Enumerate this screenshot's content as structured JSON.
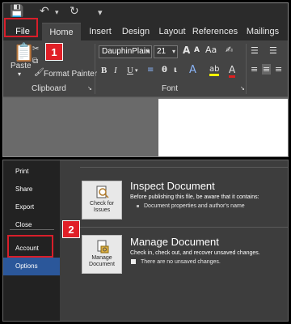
{
  "top": {
    "tabs": [
      "File",
      "Home",
      "Insert",
      "Design",
      "Layout",
      "References",
      "Mailings"
    ],
    "clipboard": {
      "paste_label": "Paste",
      "format_painter_label": "Format Painter",
      "group_label": "Clipboard"
    },
    "font": {
      "font_name": "DauphinPlain",
      "font_size": "21",
      "group_label": "Font",
      "bold": "B",
      "italic": "I",
      "underline": "U",
      "grow": "A",
      "shrink": "A",
      "aa": "Aa",
      "highlight": "ab",
      "font_color": "A"
    },
    "badges": [
      "1",
      "2"
    ]
  },
  "backstage": {
    "nav_items": [
      "Print",
      "Share",
      "Export",
      "Close",
      "Account",
      "Options"
    ],
    "inspect": {
      "tile_label": "Check for Issues",
      "title": "Inspect Document",
      "description": "Before publishing this file, be aware that it contains:",
      "bullet": "Document properties and author's name"
    },
    "manage": {
      "tile_label": "Manage Document",
      "title": "Manage Document",
      "description": "Check in, check out, and recover unsaved changes.",
      "bullet": "There are no unsaved changes."
    }
  },
  "colors": {
    "highlight_red": "#d81e2a",
    "active_nav": "#2b579a"
  }
}
